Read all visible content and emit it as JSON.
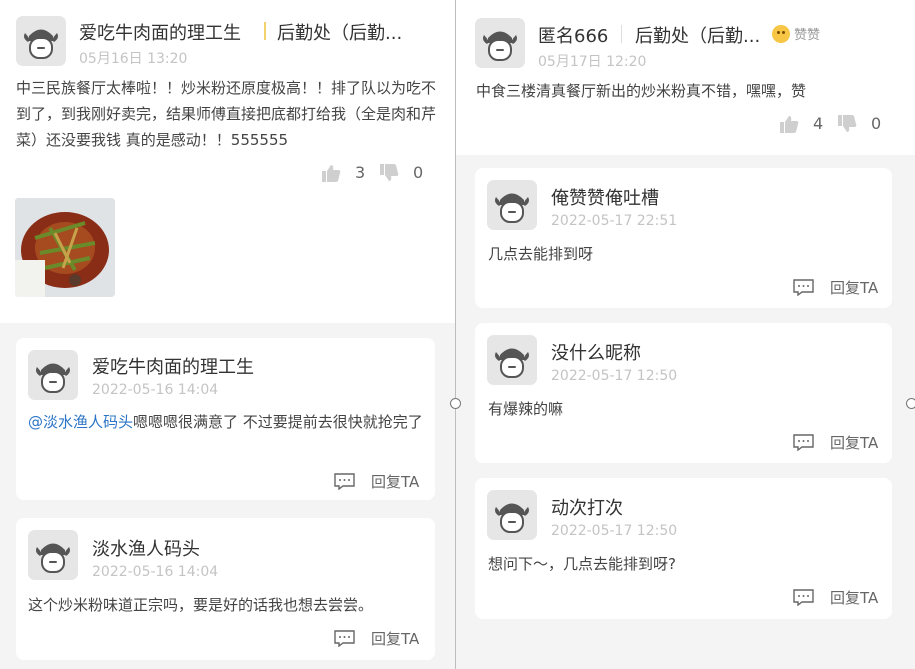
{
  "left_post": {
    "author": "爱吃牛肉面的理工生",
    "department": "后勤处（后勤...",
    "date": "05月16日 13:20",
    "content": "中三民族餐厅太棒啦！！炒米粉还原度极高！！排了队以为吃不到了，到我刚好卖完，结果师傅直接把底都打给我（全是肉和芹菜）还没要我钱 真的是感动！！555555",
    "likes": "3",
    "dislikes": "0"
  },
  "left_replies": [
    {
      "author": "爱吃牛肉面的理工生",
      "time": "2022-05-16 14:04",
      "mention": "@淡水渔人码头",
      "text": "嗯嗯嗯很满意了 不过要提前去很快就抢完了",
      "reply_label": "回复TA"
    },
    {
      "author": "淡水渔人码头",
      "time": "2022-05-16 14:04",
      "text": "这个炒米粉味道正宗吗，要是好的话我也想去尝尝。",
      "reply_label": "回复TA"
    }
  ],
  "right_post": {
    "author": "匿名666",
    "department": "后勤处（后勤...",
    "badge": "赞赞",
    "date": "05月17日 12:20",
    "content": "中食三楼清真餐厅新出的炒米粉真不错，嘿嘿，赞",
    "likes": "4",
    "dislikes": "0"
  },
  "right_replies": [
    {
      "author": "俺赞赞俺吐槽",
      "time": "2022-05-17 22:51",
      "text": "几点去能排到呀",
      "reply_label": "回复TA"
    },
    {
      "author": "没什么昵称",
      "time": "2022-05-17 12:50",
      "text": "有爆辣的嘛",
      "reply_label": "回复TA"
    },
    {
      "author": "动次打次",
      "time": "2022-05-17 12:50",
      "text": "想问下～，几点去能排到呀?",
      "reply_label": "回复TA"
    }
  ],
  "colors": {
    "background": "#f4f4f4",
    "card": "#ffffff",
    "mention": "#2b74c6",
    "date": "#c4c4c4"
  },
  "icons": [
    "avatar-icon",
    "thumbs-up-icon",
    "thumbs-down-icon",
    "comment-icon",
    "emoji-badge-icon"
  ]
}
